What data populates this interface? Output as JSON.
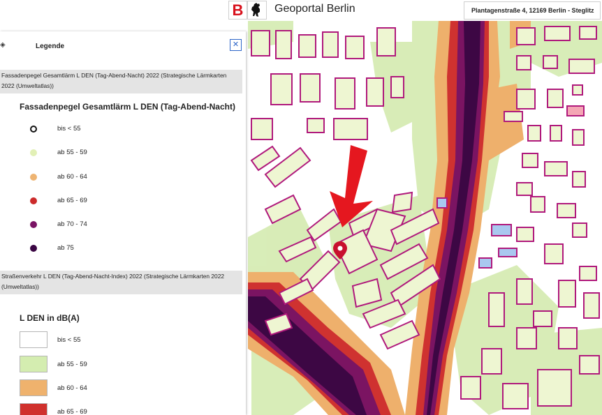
{
  "header": {
    "logo_letter": "B",
    "title": "Geoportal Berlin",
    "address": "Plantagenstraße 4, 12169 Berlin - Steglitz"
  },
  "legend": {
    "title": "Legende",
    "close_glyph": "✕",
    "icon": "layers-icon",
    "sections": [
      {
        "bar_text": "Fassadenpegel Gesamtlärm L DEN (Tag-Abend-Nacht) 2022 (Strategische Lärmkarten 2022 (Umweltatlas))",
        "heading": "Fassadenpegel Gesamtlärm L DEN (Tag-Abend-Nacht)",
        "items": [
          {
            "label": "bis < 55",
            "color": "#ffffff",
            "border": "#111111"
          },
          {
            "label": "ab 55 - 59",
            "color": "#e2f0b6"
          },
          {
            "label": "ab 60 - 64",
            "color": "#eeb472"
          },
          {
            "label": "ab 65 - 69",
            "color": "#cc2b2b"
          },
          {
            "label": "ab 70 - 74",
            "color": "#7a1364"
          },
          {
            "label": "ab 75",
            "color": "#3a0643"
          }
        ]
      },
      {
        "bar_text": "Straßenverkehr L DEN (Tag-Abend-Nacht-Index) 2022 (Strategische Lärmkarten 2022 (Umweltatlas))",
        "heading": "L DEN in dB(A)",
        "items": [
          {
            "label": "bis < 55",
            "color": "#ffffff"
          },
          {
            "label": "ab 55 - 59",
            "color": "#d4edb0"
          },
          {
            "label": "ab 60 - 64",
            "color": "#efb26d"
          },
          {
            "label": "ab 65 - 69",
            "color": "#d0312d"
          }
        ]
      }
    ]
  },
  "map": {
    "colors": {
      "background": "#ffffff",
      "light_green": "#d6ecb4",
      "orange": "#eeb06c",
      "red": "#cf3230",
      "purple": "#7b1462",
      "dark_purple": "#3d0744",
      "building_fill": "#eef6d2",
      "building_outline": "#b0197c",
      "blue_building": "#a9c8ef",
      "pink_building": "#f4a6b4",
      "arrow": "#e5171f",
      "marker": "#c8102e"
    },
    "icons": [
      "red-arrow-icon",
      "location-marker-icon"
    ]
  }
}
